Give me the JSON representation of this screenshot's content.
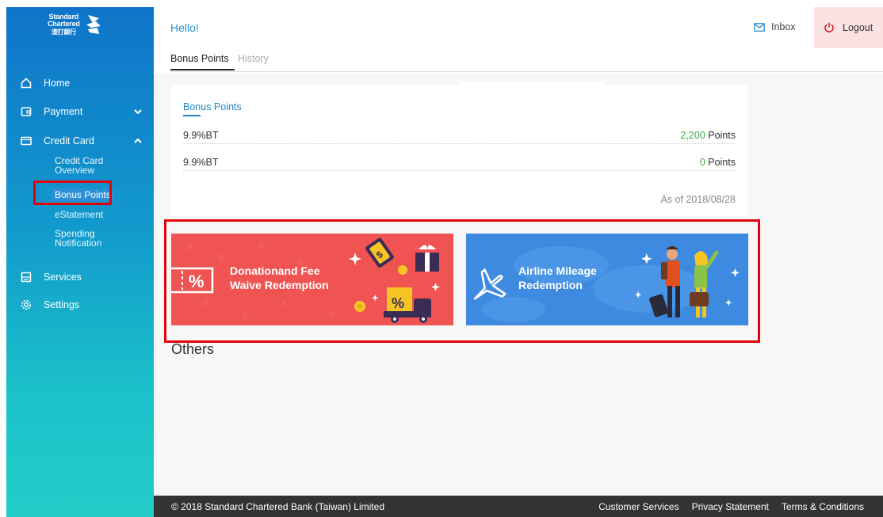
{
  "brand": {
    "line1": "Standard",
    "line2": "Chartered",
    "line3": "渣打銀行"
  },
  "sidebar": {
    "items": [
      {
        "label": "Home",
        "icon": "home-icon"
      },
      {
        "label": "Payment",
        "icon": "wallet-icon"
      },
      {
        "label": "Credit Card",
        "icon": "card-icon"
      },
      {
        "label": "Services",
        "icon": "services-icon"
      },
      {
        "label": "Settings",
        "icon": "gear-icon"
      }
    ],
    "credit_card_sub": [
      {
        "label": "Credit Card Overview"
      },
      {
        "label": "Bonus Points"
      },
      {
        "label": "eStatement"
      },
      {
        "label": "Spending Notification"
      }
    ]
  },
  "header": {
    "greeting": "Hello!",
    "inbox_label": "Inbox",
    "logout_label": "Logout"
  },
  "tabs": [
    {
      "label": "Bonus Points"
    },
    {
      "label": "History"
    }
  ],
  "card": {
    "title": "Bonus Points",
    "rows": [
      {
        "name": "9.9%BT",
        "value": "2,200",
        "unit": "Points"
      },
      {
        "name": "9.9%BT",
        "value": "0",
        "unit": "Points"
      }
    ],
    "as_of": "As of 2018/08/28"
  },
  "banners": {
    "donation": {
      "line1": "Donationand Fee",
      "line2": "Waive Redemption"
    },
    "airline": {
      "line1": "Airline Mileage",
      "line2": "Redemption"
    }
  },
  "others_title": "Others",
  "footer": {
    "copyright": "© 2018 Standard Chartered Bank (Taiwan) Limited",
    "links": [
      "Customer Services",
      "Privacy Statement",
      "Terms & Conditions"
    ]
  },
  "colors": {
    "accent": "#1e88c8",
    "points_green": "#3fae3f",
    "highlight_red": "#e3000b",
    "donation_banner": "#ef5452",
    "airline_banner": "#3d8ae0"
  }
}
